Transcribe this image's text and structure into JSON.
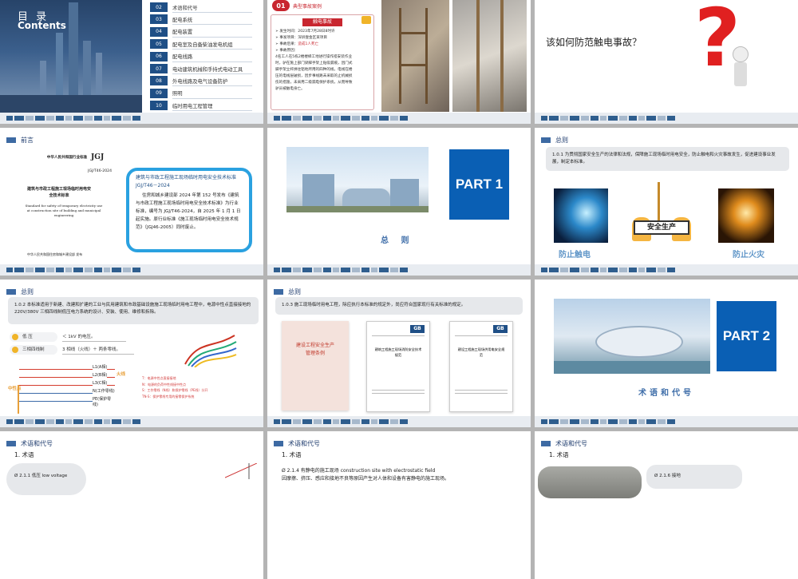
{
  "s1": {
    "title": "目 录",
    "subtitle": "Contents",
    "items": [
      {
        "num": "02",
        "label": "术语和代号"
      },
      {
        "num": "03",
        "label": "配电系统"
      },
      {
        "num": "04",
        "label": "配电装置"
      },
      {
        "num": "05",
        "label": "配电室及自备柴油发电机组"
      },
      {
        "num": "06",
        "label": "配电线路"
      },
      {
        "num": "07",
        "label": "电动建筑机械和手持式电动工具"
      },
      {
        "num": "08",
        "label": "外电线路及电气设备防护"
      },
      {
        "num": "09",
        "label": "照明"
      },
      {
        "num": "10",
        "label": "临时用电工程管理"
      }
    ]
  },
  "s2": {
    "badge": "01",
    "case_label": "典型事故案例",
    "heading": "触电事故",
    "lines": [
      "➢ 发生时间：2023年7月28日8时许",
      "➢ 事发项目：深圳壹金区某项目",
      "➢ 事故后果：",
      "➢ 事故原因：",
      "4名工人在5栋2楼楼梯工地进行操作搭安装作业",
      "时，驴在施上部门梁脚手架上贴吸漏痕，因门式",
      "脚手架立杆拼往铝地所用的四种的线，电线在楼",
      "压的电线层破损，因步事线路未采取的止机械损",
      "伤的措施，未采用二级漏电保护系统，从而导致",
      "驴员被触电身亡。"
    ],
    "casualty": "造成1人死亡"
  },
  "s3": {
    "question": "该如何防范触电事故？"
  },
  "s4": {
    "section": "前言",
    "doc_title": "中华人民共和国行业标准",
    "doc_std": "JGJ",
    "doc_code": "JGJ/T46-2024",
    "doc_name": "建筑与市政工程施工现场临时用电安全技术标准",
    "doc_en": "Standard for safety of temporary electricity use at construction site of building and municipal engineering",
    "doc_pub": "中华人民共和国住房和城乡建设部 发布",
    "callout_title": "建筑与市政工程施工现场临时用电安全技术标准JGJ/T46－2024",
    "callout_body": "住房和城乡建设部 2024 年第 152 号发布《建筑与市政工程施工现场临时用电安全技术标准》为行业标准，编号为 JGJ/T46-2024，自 2025 年 1 月 1 日起实施。原行业标准《施工现场临时用电安全技术规范》（JGJ46-2005）同时废止。"
  },
  "s5": {
    "part": "PART 1",
    "caption": "总 则"
  },
  "s6": {
    "section": "总则",
    "body": "1.0.1 为贯彻国家安全生产的法律和法规，保障施工现场临时用电安全，防止触电和火灾事故发生，促进建设事业发展，制定本标准。",
    "label_left": "防止触电",
    "label_center": "安全生产",
    "label_right": "防止火灾"
  },
  "s7": {
    "section": "总则",
    "body": "1.0.2 本标准适用于新建、改建和扩建的工业与民用建筑和市政基础设施施工现场临时用电工程中，电源中性点直接接地的 220V/380V 三相四线制低压电力系统的设计、安装、使用、维修和拆除。",
    "low_label": "低 压",
    "low_desc": "＜ 1kV 的电压。",
    "three_label": "三相四线制",
    "three_desc": "3 相线（火线）＋ 两条零线。",
    "wires": [
      "L1(A相)",
      "L2(B相)",
      "L3(C相)",
      "N(工作零线)",
      "PE(保护零线)"
    ],
    "fire": "火线",
    "neutral": "中性点",
    "notes": [
      "T：电源中性点直接接地",
      "N：电源的负荷中性线接中性点",
      "S：工作零线（N线）和保护零线（PE线）分开",
      "TN-S：保护零线专用的接零保护系统"
    ]
  },
  "s8": {
    "section": "总则",
    "body": "1.0.3 施工现场临时用电工程，除应执行本标准的规定外，尚应符合国家现行有关标准的规定。",
    "book_title": "建设工程安全生产管理条例",
    "gb": "GB",
    "doc1": "建筑工程施工现场消防安全技术规范",
    "doc2": "建设工程施工现场供用电安全规范"
  },
  "s9": {
    "part": "PART 2",
    "caption": "术语和代号"
  },
  "s10": {
    "section": "术语和代号",
    "sub": "1. 术语",
    "item": "Ø 2.1.1 低压 low voltage"
  },
  "s11": {
    "section": "术语和代号",
    "sub": "1. 术语",
    "item": "Ø 2.1.4 有静电的施工现场 construction site with electrostatic field",
    "line2": "因摩擦、挤压、感应和接地不良等原因产生对人体和设备有害静电的施工现场。"
  },
  "s12": {
    "section": "术语和代号",
    "sub": "1. 术语",
    "item": "Ø 2.1.6 接地"
  }
}
